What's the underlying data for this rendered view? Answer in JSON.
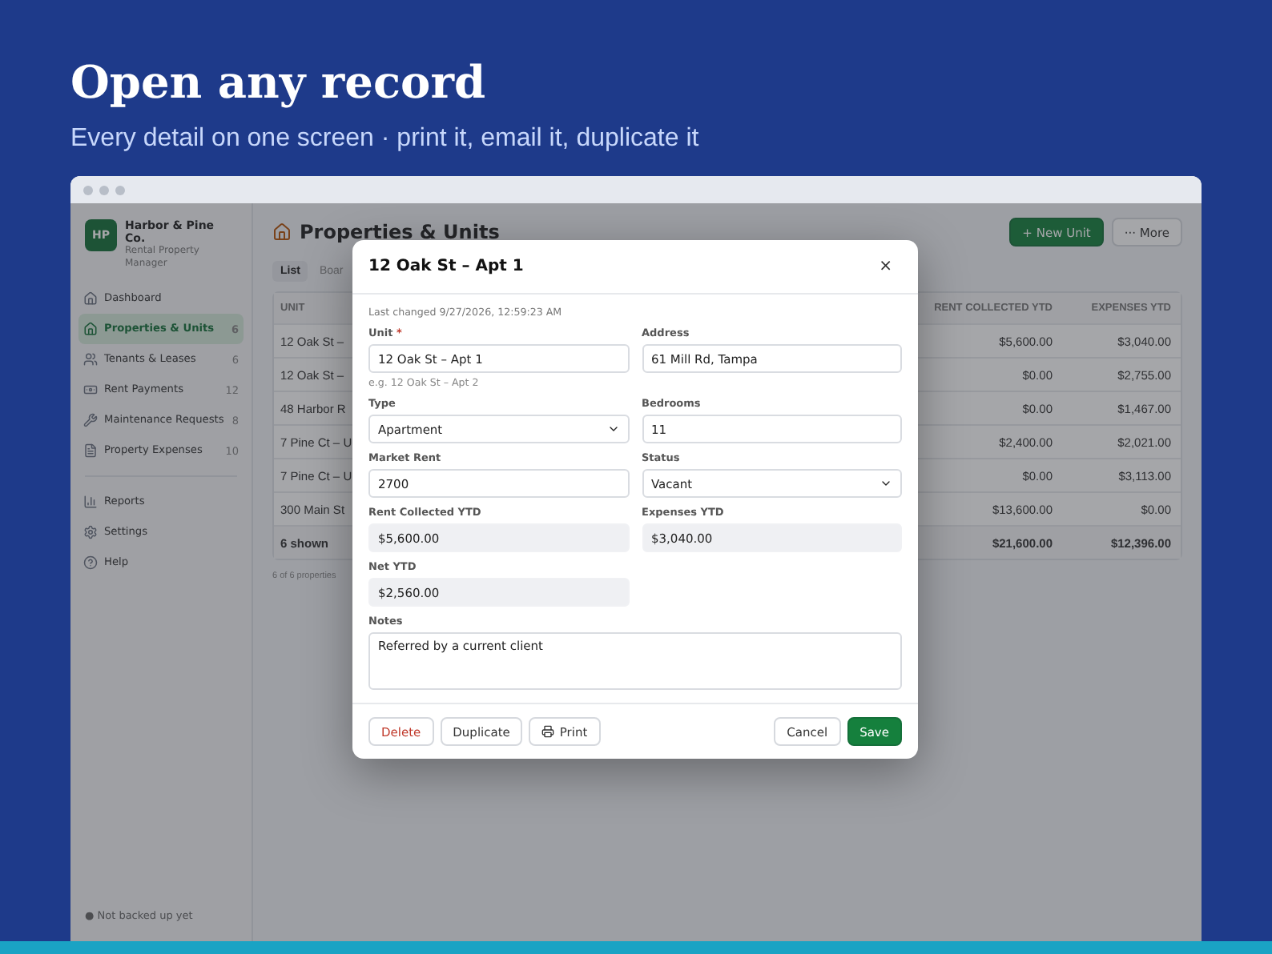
{
  "hero": {
    "title": "Open any record",
    "subtitle": "Every detail on one screen · print it, email it, duplicate it"
  },
  "sidebar": {
    "brand": {
      "initials": "HP",
      "name": "Harbor & Pine Co.",
      "tagline": "Rental Property Manager"
    },
    "nav": [
      {
        "label": "Dashboard",
        "selected": false
      },
      {
        "label": "Properties & Units",
        "count": "6",
        "selected": true
      },
      {
        "label": "Tenants & Leases",
        "count": "6",
        "selected": false
      },
      {
        "label": "Rent Payments",
        "count": "12",
        "selected": false
      },
      {
        "label": "Maintenance Requests",
        "count": "8",
        "selected": false
      },
      {
        "label": "Property Expenses",
        "count": "10",
        "selected": false
      }
    ],
    "nav_secondary": [
      {
        "label": "Reports",
        "selected": false
      },
      {
        "label": "Settings",
        "selected": false
      },
      {
        "label": "Help",
        "selected": false
      }
    ],
    "footer": "● Not backed up yet"
  },
  "main": {
    "title": "Properties & Units",
    "actions": [
      {
        "label": "+ New Unit",
        "kind": "primary"
      },
      {
        "label": "··· More",
        "kind": "plain"
      }
    ],
    "view_tabs": [
      {
        "label": "List",
        "selected": true
      },
      {
        "label": "Boar",
        "selected": false
      }
    ],
    "table": {
      "columns": [
        "UNIT",
        "RENT COLLECTED YTD",
        "EXPENSES YTD"
      ],
      "rows": [
        {
          "unit": "12 Oak St –",
          "rent": "$5,600.00",
          "expenses": "$3,040.00"
        },
        {
          "unit": "12 Oak St –",
          "rent": "$0.00",
          "expenses": "$2,755.00"
        },
        {
          "unit": "48 Harbor R",
          "rent": "$0.00",
          "expenses": "$1,467.00"
        },
        {
          "unit": "7 Pine Ct – U",
          "rent": "$2,400.00",
          "expenses": "$2,021.00"
        },
        {
          "unit": "7 Pine Ct – U",
          "rent": "$0.00",
          "expenses": "$3,113.00"
        },
        {
          "unit": "300 Main St",
          "rent": "$13,600.00",
          "expenses": "$0.00"
        }
      ],
      "total": {
        "unit": "6 shown",
        "rent": "$21,600.00",
        "expenses": "$12,396.00"
      }
    },
    "footnote": "6 of 6 properties"
  },
  "dialog": {
    "title": "12 Oak St – Apt 1",
    "close": "×",
    "meta": "Last changed 9/27/2026, 12:59:23 AM",
    "fields": [
      {
        "label": "Unit",
        "required_mark": "*",
        "kind": "text",
        "value": "12 Oak St – Apt 1",
        "hint": "e.g. 12 Oak St – Apt 2"
      },
      {
        "label": "Address",
        "kind": "text",
        "value": "61 Mill Rd, Tampa"
      },
      {
        "label": "Type",
        "kind": "select",
        "value": "Apartment"
      },
      {
        "label": "Bedrooms",
        "kind": "text",
        "value": "11"
      },
      {
        "label": "Market Rent",
        "kind": "text",
        "value": "2700"
      },
      {
        "label": "Status",
        "kind": "select",
        "value": "Vacant"
      },
      {
        "label": "Rent Collected YTD",
        "kind": "readonly",
        "value": "$5,600.00"
      },
      {
        "label": "Expenses YTD",
        "kind": "readonly",
        "value": "$3,040.00"
      },
      {
        "label": "Net YTD",
        "kind": "readonly",
        "value": "$2,560.00"
      },
      {
        "label": "Notes",
        "kind": "textarea",
        "value": "Referred by a current client"
      }
    ],
    "left_buttons": [
      {
        "label": "Delete",
        "kind": "danger"
      },
      {
        "label": "Duplicate",
        "kind": "plain"
      },
      {
        "label": "Print",
        "kind": "print"
      }
    ],
    "right_buttons": [
      {
        "label": "Cancel",
        "kind": "plain"
      },
      {
        "label": "Save",
        "kind": "primary"
      }
    ]
  }
}
